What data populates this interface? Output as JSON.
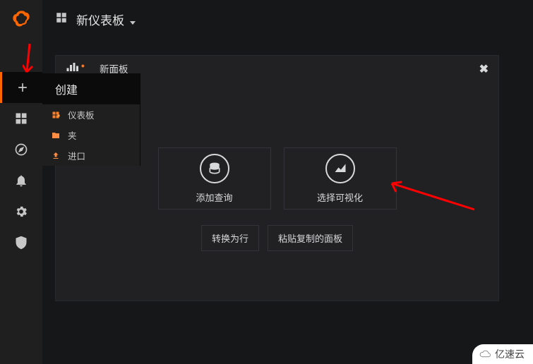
{
  "topbar": {
    "title": "新仪表板"
  },
  "flyout": {
    "header": "创建",
    "items": [
      {
        "label": "仪表板"
      },
      {
        "label": "夹"
      },
      {
        "label": "进口"
      }
    ]
  },
  "panel": {
    "title": "新面板",
    "addQuery": "添加查询",
    "selectViz": "选择可视化",
    "convertRow": "转换为行",
    "pastePanel": "粘贴复制的面板"
  },
  "watermark": {
    "text": "亿速云"
  }
}
